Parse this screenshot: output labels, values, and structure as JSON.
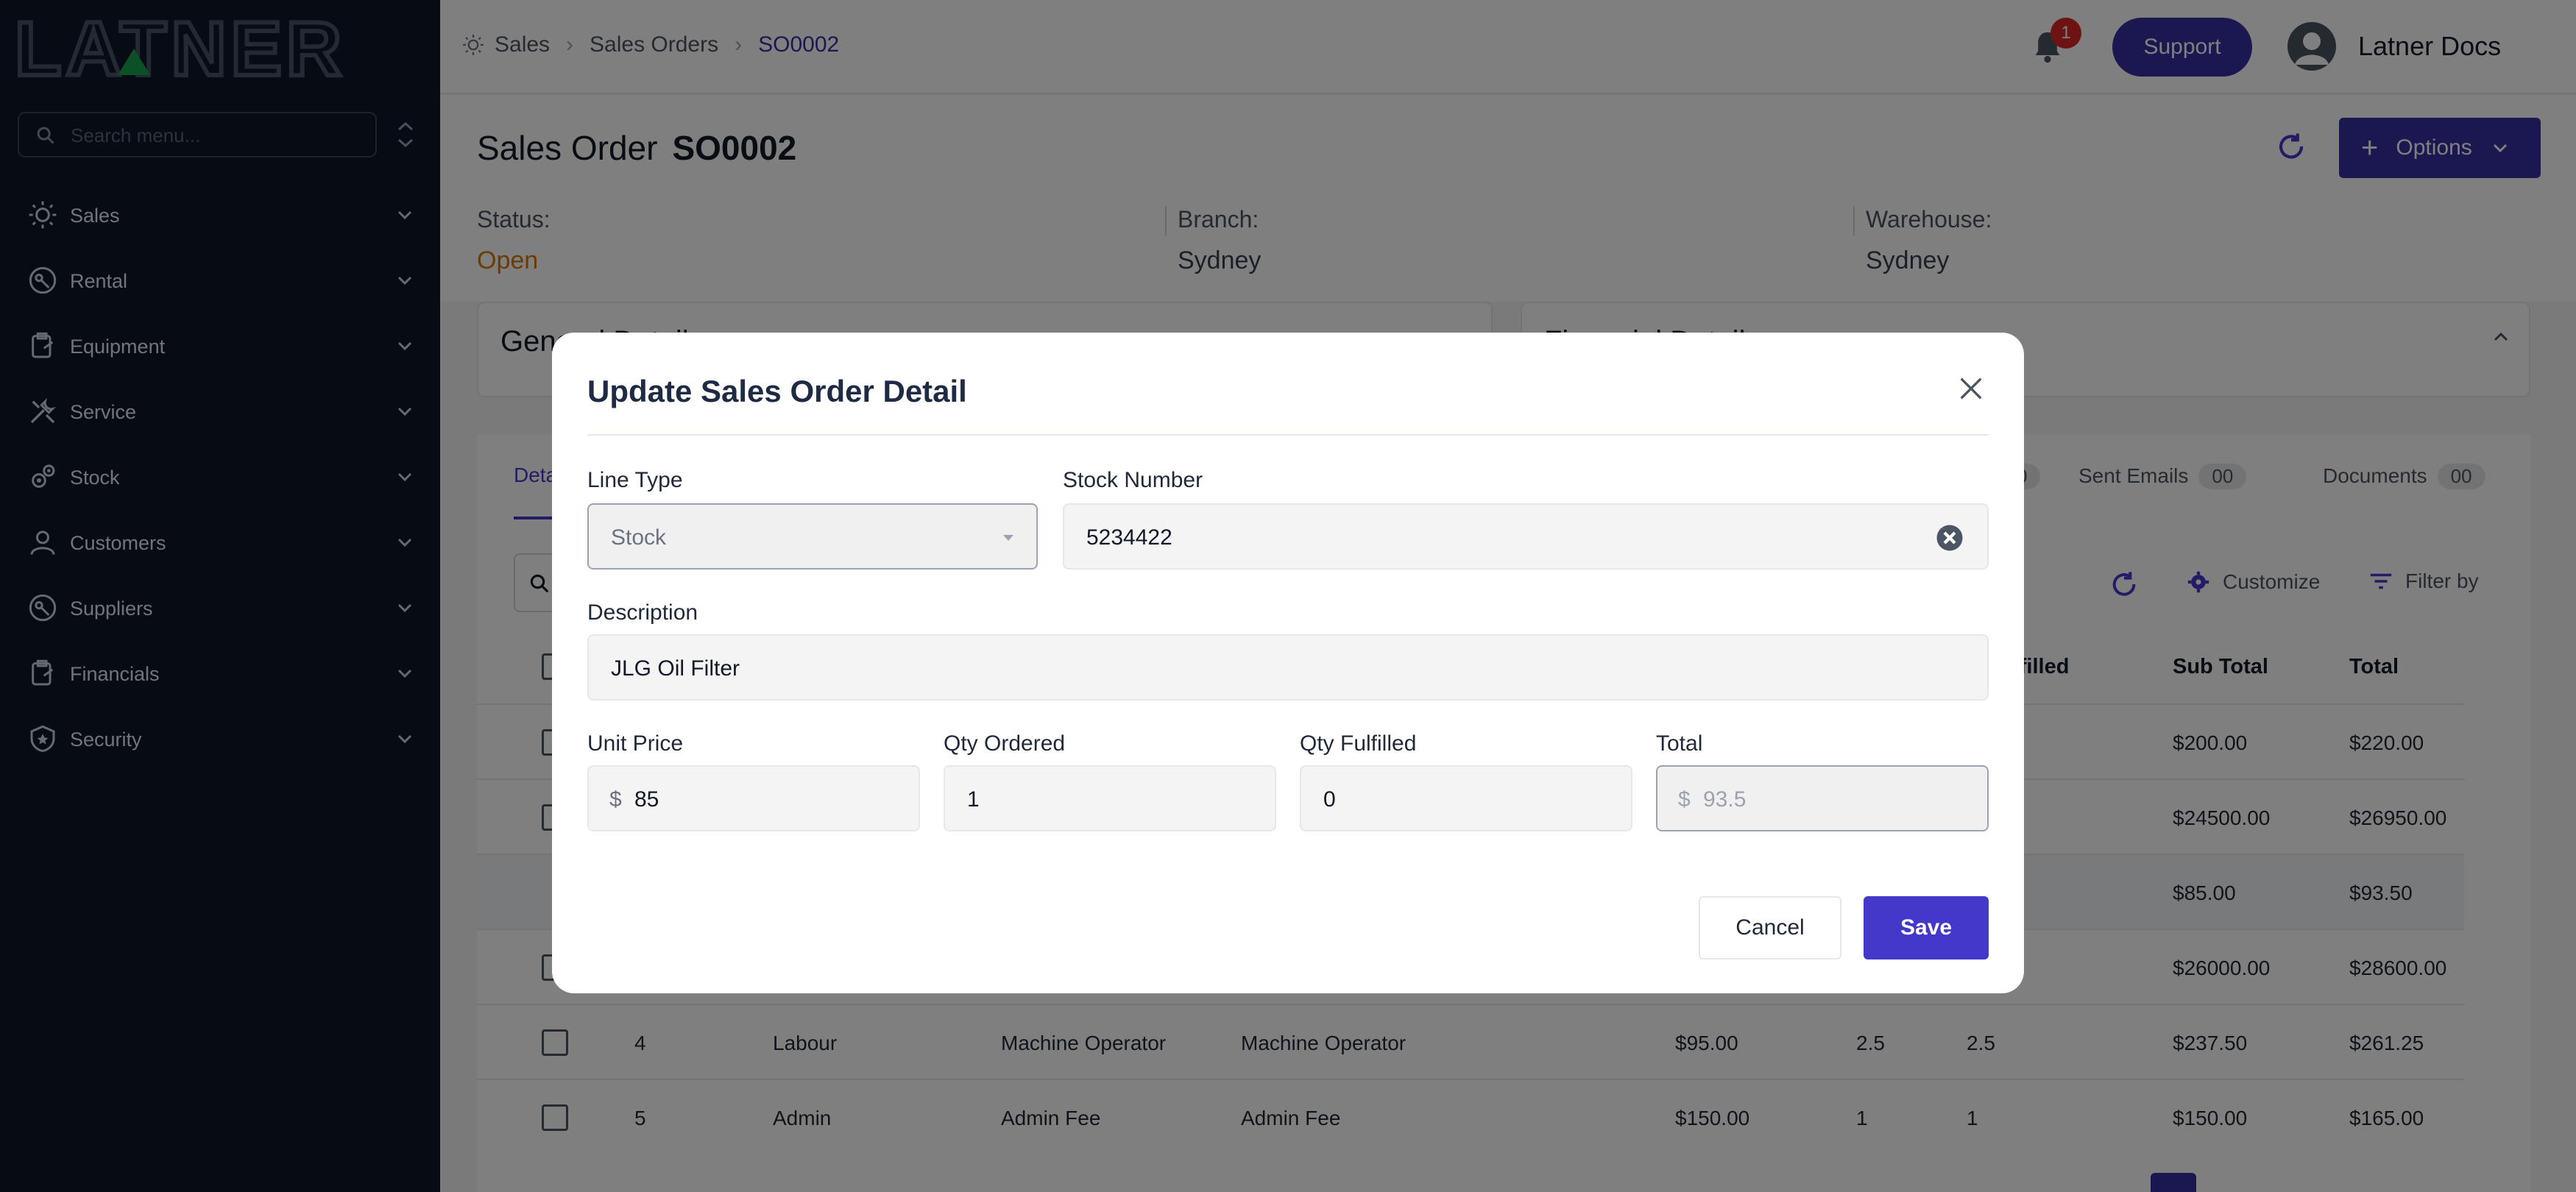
{
  "app": {
    "logo_text": "LATNER"
  },
  "sidebar": {
    "search_placeholder": "Search menu...",
    "items": [
      {
        "label": "Sales"
      },
      {
        "label": "Rental"
      },
      {
        "label": "Equipment"
      },
      {
        "label": "Service"
      },
      {
        "label": "Stock"
      },
      {
        "label": "Customers"
      },
      {
        "label": "Suppliers"
      },
      {
        "label": "Financials"
      },
      {
        "label": "Security"
      }
    ]
  },
  "topbar": {
    "breadcrumbs": [
      "Sales",
      "Sales Orders",
      "SO0002"
    ],
    "notification_count": "1",
    "support_label": "Support",
    "user_name": "Latner Docs"
  },
  "header": {
    "title_prefix": "Sales Order",
    "order_number": "SO0002",
    "options_label": "Options",
    "status_label": "Status:",
    "status_value": "Open",
    "branch_label": "Branch:",
    "branch_value": "Sydney",
    "warehouse_label": "Warehouse:",
    "warehouse_value": "Sydney",
    "status_color": "#d97706"
  },
  "cards": {
    "general": "General Details",
    "financial": "Financial Details"
  },
  "tabs": [
    {
      "label": "Deta"
    },
    {
      "label": "Sent Emails",
      "count": "00"
    },
    {
      "label": "Documents",
      "count": "00"
    },
    {
      "partial_count": "0"
    }
  ],
  "toolbar": {
    "customize": "Customize",
    "filter": "Filter by"
  },
  "table": {
    "headers": {
      "fulfilled": "ulfilled",
      "subtotal": "Sub Total",
      "total": "Total"
    },
    "rows": [
      {
        "subtotal": "$200.00",
        "total": "$220.00"
      },
      {
        "subtotal": "$24500.00",
        "total": "$26950.00"
      },
      {
        "subtotal": "$85.00",
        "total": "$93.50"
      },
      {
        "subtotal": "$26000.00",
        "total": "$28600.00"
      },
      {
        "no": "4",
        "type": "Labour",
        "stock": "Machine Operator",
        "desc": "Machine Operator",
        "price": "$95.00",
        "qty": "2.5",
        "ful": "2.5",
        "subtotal": "$237.50",
        "total": "$261.25"
      },
      {
        "no": "5",
        "type": "Admin",
        "stock": "Admin Fee",
        "desc": "Admin Fee",
        "price": "$150.00",
        "qty": "1",
        "ful": "1",
        "subtotal": "$150.00",
        "total": "$165.00"
      }
    ]
  },
  "modal": {
    "title": "Update Sales Order Detail",
    "line_type_label": "Line Type",
    "line_type_value": "Stock",
    "stock_number_label": "Stock Number",
    "stock_number_value": "5234422",
    "description_label": "Description",
    "description_value": "JLG Oil Filter",
    "unit_price_label": "Unit Price",
    "currency_symbol": "$",
    "unit_price_value": "85",
    "qty_ordered_label": "Qty Ordered",
    "qty_ordered_value": "1",
    "qty_fulfilled_label": "Qty Fulfilled",
    "qty_fulfilled_value": "0",
    "total_label": "Total",
    "total_value": "93.5",
    "cancel_label": "Cancel",
    "save_label": "Save"
  }
}
